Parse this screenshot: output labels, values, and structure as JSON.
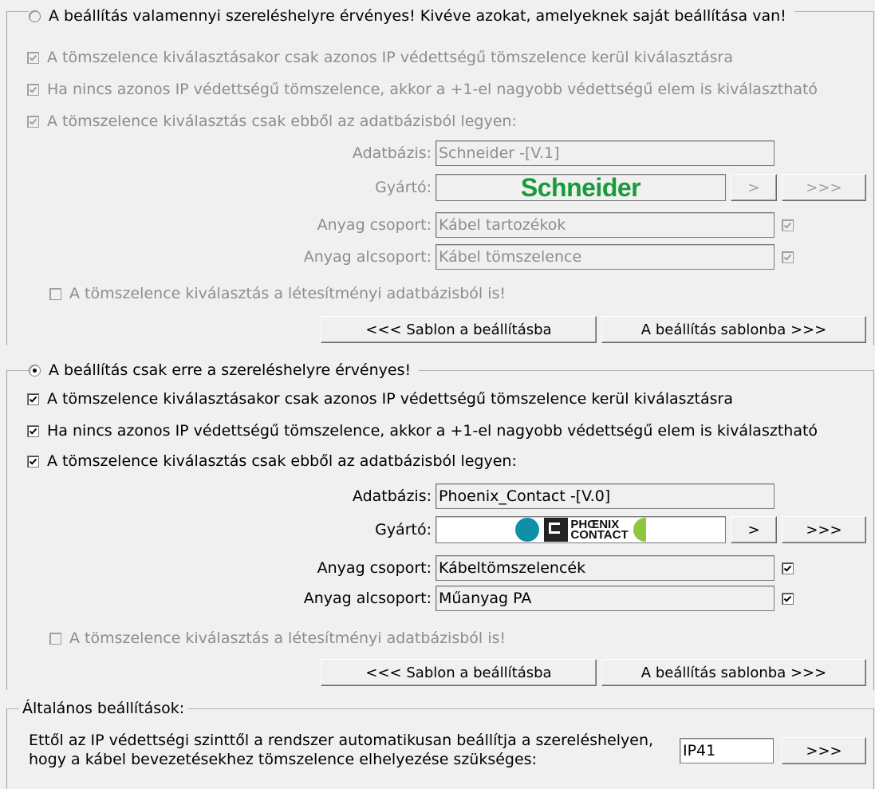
{
  "section1": {
    "radio_label": "A beállítás valamennyi szereléshelyre érvényes! Kivéve azokat, amelyeknek saját beállítása van!",
    "radio_selected": false,
    "check1": "A tömszelence kiválasztásakor csak azonos IP védettségű tömszelence kerül kiválasztásra",
    "check2": "Ha nincs azonos IP védettségű tömszelence, akkor a +1-el nagyobb védettségű elem is kiválasztható",
    "check3": "A tömszelence kiválasztás csak ebből az adatbázisból legyen:",
    "adatbazis_label": "Adatbázis:",
    "adatbazis_value": "Schneider -[V.1]",
    "gyarto_label": "Gyártó:",
    "gyarto_logo_text": "Schneider",
    "gyarto_logo_icon": "schneider-logo",
    "next_btn": ">",
    "more_btn": ">>>",
    "csoport_label": "Anyag csoport:",
    "csoport_value": "Kábel tartozékok",
    "alcsoport_label": "Anyag alcsoport:",
    "alcsoport_value": "Kábel tömszelence",
    "letesitmenyi": "A tömszelence kiválasztás a létesítményi adatbázisból is!",
    "sablon_btn": "<<< Sablon a beállításba",
    "beallitas_btn": "A beállítás sablonba >>>"
  },
  "section2": {
    "radio_label": "A beállítás csak erre a szereléshelyre érvényes!",
    "radio_selected": true,
    "check1": "A tömszelence kiválasztásakor csak azonos IP védettségű tömszelence kerül kiválasztásra",
    "check2": "Ha nincs azonos IP védettségű tömszelence, akkor a +1-el nagyobb védettségű elem is kiválasztható",
    "check3": "A tömszelence kiválasztás csak ebből az adatbázisból legyen:",
    "adatbazis_label": "Adatbázis:",
    "adatbazis_value": "Phoenix_Contact -[V.0]",
    "gyarto_label": "Gyártó:",
    "gyarto_logo_text_1": "PHŒNIX",
    "gyarto_logo_text_2": "CONTACT",
    "gyarto_logo_icon": "phoenix-contact-logo",
    "next_btn": ">",
    "more_btn": ">>>",
    "csoport_label": "Anyag csoport:",
    "csoport_value": "Kábeltömszelencék",
    "alcsoport_label": "Anyag alcsoport:",
    "alcsoport_value": "Műanyag PA",
    "letesitmenyi": "A tömszelence kiválasztás a létesítményi adatbázisból is!",
    "sablon_btn": "<<< Sablon a beállításba",
    "beallitas_btn": "A beállítás sablonba >>>"
  },
  "general": {
    "title": "Általános beállítások:",
    "text_line1": "Ettől az IP védettségi szinttől a rendszer automatikusan beállítja a szereléshelyen,",
    "text_line2": "hogy a kábel bevezetésekhez tömszelence elhelyezése szükséges:",
    "ip_value": "IP41",
    "more_btn": ">>>"
  },
  "colors": {
    "background": "#f0f0f0",
    "disabled_text": "#8d8d8d",
    "schneider_green": "#179b3b",
    "phoenix_blue": "#0f8fa8",
    "phoenix_green": "#8dc63f"
  }
}
